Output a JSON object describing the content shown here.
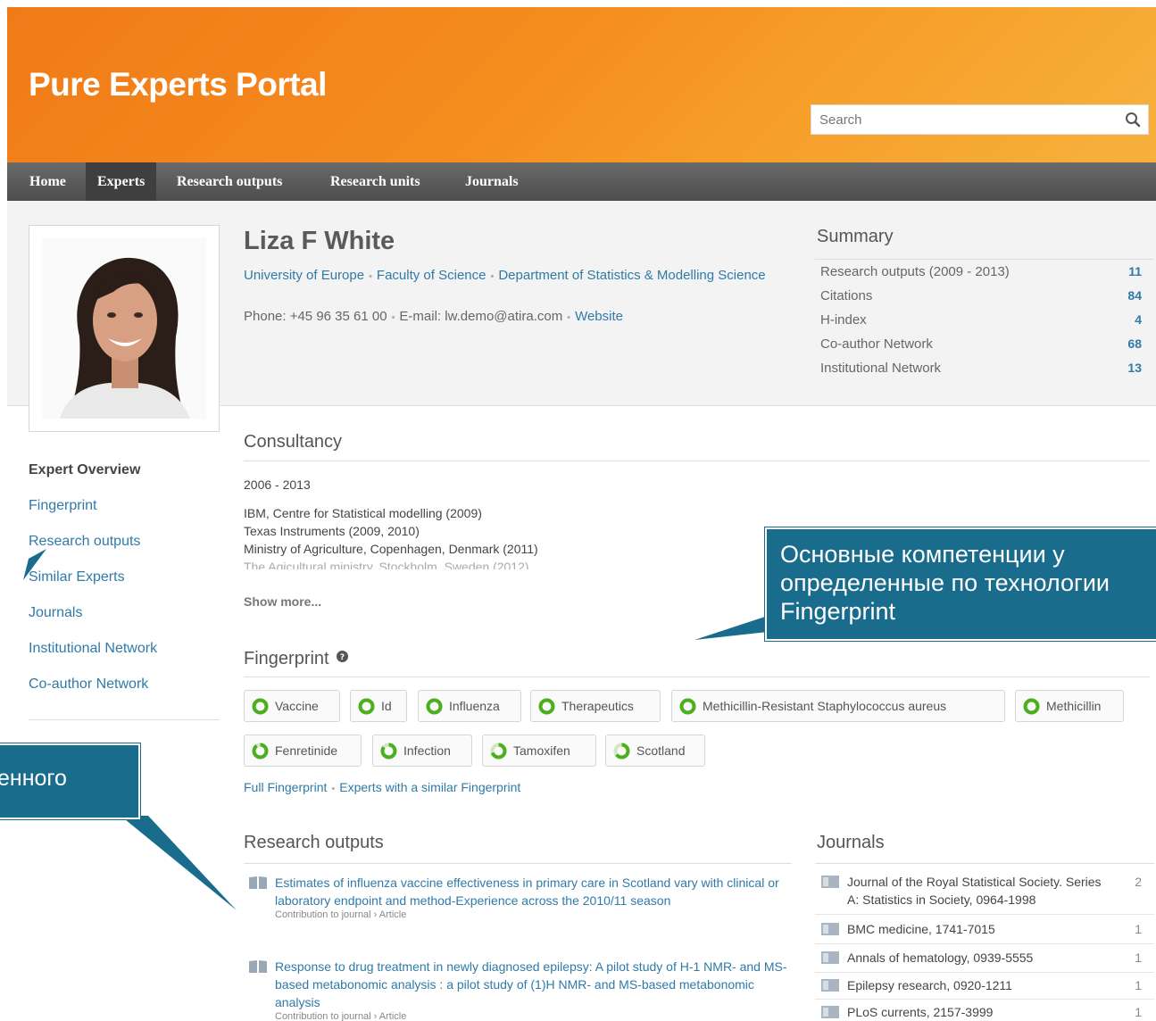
{
  "header": {
    "title": "Pure Experts Portal",
    "search_placeholder": "Search"
  },
  "nav": {
    "items": [
      "Home",
      "Experts",
      "Research outputs",
      "Research units",
      "Journals"
    ],
    "active": "Experts"
  },
  "profile": {
    "name": "Liza F White",
    "affiliation": [
      "University of Europe",
      "Faculty of Science",
      "Department of Statistics & Modelling Science"
    ],
    "phone": "Phone: +45 96 35 61 00",
    "email": "E-mail: lw.demo@atira.com",
    "website": "Website"
  },
  "summary": {
    "title": "Summary",
    "rows": [
      {
        "label": "Research outputs (2009 - 2013)",
        "value": "11"
      },
      {
        "label": "Citations",
        "value": "84"
      },
      {
        "label": "H-index",
        "value": "4"
      },
      {
        "label": "Co-author Network",
        "value": "68"
      },
      {
        "label": "Institutional Network",
        "value": "13"
      }
    ]
  },
  "sidenav": [
    "Expert Overview",
    "Fingerprint",
    "Research outputs",
    "Similar Experts",
    "Journals",
    "Institutional Network",
    "Co-author Network"
  ],
  "consultancy": {
    "title": "Consultancy",
    "years": "2006 - 2013",
    "items": [
      "IBM, Centre for Statistical modelling (2009)",
      "Texas Instruments (2009, 2010)",
      "Ministry of Agriculture, Copenhagen, Denmark (2011)",
      "The Agicultural ministry, Stockholm, Sweden (2012)"
    ],
    "show_more": "Show more..."
  },
  "fingerprint": {
    "title": "Fingerprint",
    "help_icon": "question-circle-icon",
    "tags": [
      {
        "label": "Vaccine",
        "weight": 1.0
      },
      {
        "label": "Id",
        "weight": 1.0
      },
      {
        "label": "Influenza",
        "weight": 1.0
      },
      {
        "label": "Therapeutics",
        "weight": 1.0
      },
      {
        "label": "Methicillin-Resistant Staphylococcus aureus",
        "weight": 1.0
      },
      {
        "label": "Methicillin",
        "weight": 1.0
      },
      {
        "label": "Fenretinide",
        "weight": 0.9
      },
      {
        "label": "Infection",
        "weight": 0.85
      },
      {
        "label": "Tamoxifen",
        "weight": 0.7
      },
      {
        "label": "Scotland",
        "weight": 0.65
      }
    ],
    "full_link": "Full Fingerprint",
    "similar_link": "Experts with a similar Fingerprint"
  },
  "research_outputs": {
    "title": "Research outputs",
    "items": [
      {
        "title": "Estimates of influenza vaccine effectiveness in primary care in Scotland vary with clinical or laboratory endpoint and method-Experience across the 2010/11 season",
        "type": "Contribution to journal › Article"
      },
      {
        "title": "Response to drug treatment in newly diagnosed epilepsy: A pilot study of H-1 NMR- and MS-based metabonomic analysis : a pilot study of (1)H NMR- and MS-based metabonomic analysis",
        "type": "Contribution to journal › Article"
      }
    ]
  },
  "journals": {
    "title": "Journals",
    "items": [
      {
        "name": "Journal of the Royal Statistical Society. Series A: Statistics in Society, 0964-1998",
        "count": "2"
      },
      {
        "name": "BMC medicine, 1741-7015",
        "count": "1"
      },
      {
        "name": "Annals of hematology, 0939-5555",
        "count": "1"
      },
      {
        "name": "Epilepsy research, 0920-1211",
        "count": "1"
      },
      {
        "name": "PLoS currents, 2157-3999",
        "count": "1"
      }
    ]
  },
  "callouts": {
    "top": [
      "Основные компетенции у",
      "определенные по технологии",
      "Fingerprint"
    ],
    "left": "енного"
  },
  "colors": {
    "accent": "#f58d1e",
    "link": "#2f7aa8",
    "callout": "#1a6c8d",
    "ring": "#4caf1e"
  }
}
